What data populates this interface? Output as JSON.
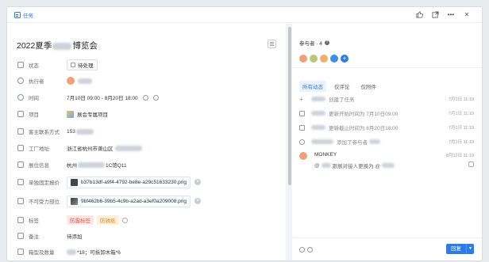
{
  "topbar": {
    "tab_label": "任务",
    "actions": [
      "thumb-up-icon",
      "share-icon",
      "more-icon",
      "close-icon"
    ]
  },
  "task": {
    "title_prefix": "2022夏季",
    "title_suffix": "博览会"
  },
  "fields": [
    {
      "label": "状态",
      "value": "待处理",
      "icon": "status-icon"
    },
    {
      "label": "执行者",
      "value": "杨家锋",
      "icon": "user-icon"
    },
    {
      "label": "时间",
      "value": "7月10日 09:00  -  8月20日 18:00",
      "icon": "clock-icon"
    },
    {
      "label": "项目",
      "value": "展会专属项目",
      "icon": "project-icon"
    },
    {
      "label": "客主联系方式",
      "value": "153",
      "icon": "contact-icon"
    },
    {
      "label": "工厂地址",
      "value": "浙江省杭州市萧山区",
      "icon": "address-icon"
    },
    {
      "label": "展位信息",
      "value": "杭州",
      "value_suffix": "1C馆Q11",
      "icon": "booth-icon"
    },
    {
      "label": "单独固定报价",
      "value": "b37b13df-a9f4-4792-be8e-a29c51633230.png",
      "icon": "file-icon"
    },
    {
      "label": "不可受力部位",
      "value": "9bf462b6-39b5-4c9b-a2ad-a3ef0a209008.png",
      "icon": "file-icon"
    },
    {
      "label": "标签",
      "tags": [
        "防震标签",
        "防锈纸"
      ],
      "icon": "tag-icon"
    },
    {
      "label": "备注",
      "value": "待添加",
      "icon": "note-icon"
    },
    {
      "label": "箱型及数量",
      "value": "*18；可拆卸木箱*6",
      "icon": "box-icon"
    }
  ],
  "participants": {
    "label": "参与者 · 4",
    "help": "?",
    "avatar_colors": [
      "#f3a07a",
      "#b8c77a",
      "#f0b06a",
      "#3b8fe8"
    ],
    "add": "+"
  },
  "activity_tabs": [
    "所有动态",
    "仅评论",
    "仅附件"
  ],
  "activities": [
    {
      "icon": "plus-icon",
      "text": "创建了任务",
      "time": "7月1日 11:19"
    },
    {
      "icon": "calendar-icon",
      "text": "更新开始时间为 7月10日09:00",
      "time": "7月1日 11:19"
    },
    {
      "icon": "calendar-icon",
      "text": "更新截止时间为 8月20日18:00",
      "time": "7月1日 11:19"
    },
    {
      "icon": "user-icon",
      "text": "添加了参与者",
      "time": "7月1日 11:19"
    }
  ],
  "comment": {
    "author": "MONKEY",
    "time": "8月12日 11:19",
    "text": "@",
    "text_middle": "跟展对接人更换为 @",
    "avatar_color": "#f3a07a"
  },
  "reply_button": "回复",
  "reply_dropdown": "▼"
}
